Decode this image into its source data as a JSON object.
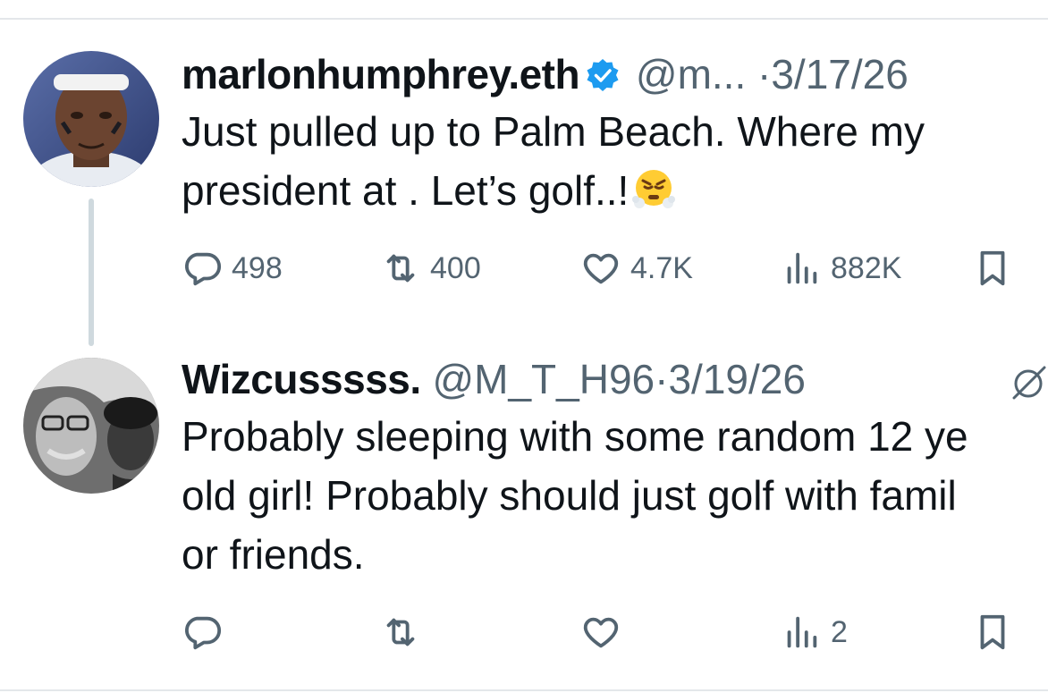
{
  "tweets": [
    {
      "name": "marlonhumphrey.eth",
      "handle": "@m...",
      "separator": "·",
      "date": "3/17/26",
      "text": "Just pulled up to Palm Beach. Where my\npresident at . Let’s golf..!",
      "emoji": "face-with-steam-from-nose",
      "verified": true,
      "stats": {
        "replies": "498",
        "reposts": "400",
        "likes": "4.7K",
        "views": "882K"
      }
    },
    {
      "name": "Wizcusssss.",
      "handle": "@M_T_H96",
      "separator": "·",
      "date": "3/19/26",
      "text_lines": [
        "Probably sleeping with some random 12 ye",
        "old girl! Probably should just golf with famil",
        "or friends."
      ],
      "stats": {
        "replies": "",
        "reposts": "",
        "likes": "",
        "views": "2"
      }
    }
  ],
  "colors": {
    "verified": "#1d9bf0",
    "muted": "#536471",
    "text": "#0f1419",
    "thread_line": "#cfd9de"
  }
}
